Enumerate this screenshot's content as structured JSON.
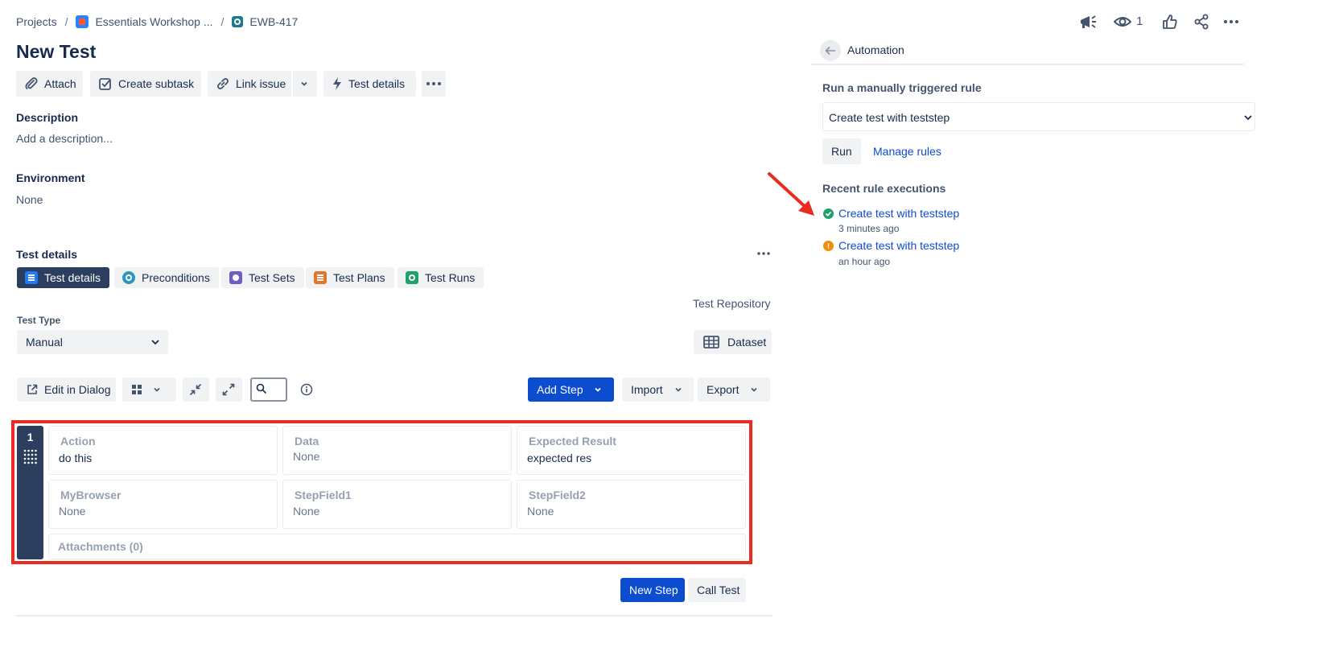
{
  "breadcrumb": {
    "projects": "Projects",
    "project": "Essentials Workshop ...",
    "issue_key": "EWB-417"
  },
  "top_actions": {
    "watch_count": "1"
  },
  "issue": {
    "title": "New Test"
  },
  "toolbar": {
    "attach": "Attach",
    "create_subtask": "Create subtask",
    "link_issue": "Link issue",
    "test_details": "Test details"
  },
  "description": {
    "label": "Description",
    "placeholder": "Add a description..."
  },
  "environment": {
    "label": "Environment",
    "value": "None"
  },
  "test_details_section": {
    "label": "Test details",
    "tabs": [
      {
        "label": "Test details",
        "color": "#1d7afc"
      },
      {
        "label": "Preconditions",
        "color": "#2898bd"
      },
      {
        "label": "Test Sets",
        "color": "#6e5dc6"
      },
      {
        "label": "Test Plans",
        "color": "#e2762c"
      },
      {
        "label": "Test Runs",
        "color": "#22a06b"
      }
    ],
    "test_repository": "Test Repository",
    "test_type_label": "Test Type",
    "test_type_value": "Manual",
    "dataset": "Dataset"
  },
  "steps_toolbar": {
    "edit_in_dialog": "Edit in Dialog",
    "add_step": "Add Step",
    "import": "Import",
    "export": "Export"
  },
  "step": {
    "number": "1",
    "action_label": "Action",
    "action_value": "do this",
    "data_label": "Data",
    "data_value": "None",
    "expected_label": "Expected Result",
    "expected_value": "expected res",
    "mybrowser_label": "MyBrowser",
    "mybrowser_value": "None",
    "stepfield1_label": "StepField1",
    "stepfield1_value": "None",
    "stepfield2_label": "StepField2",
    "stepfield2_value": "None",
    "attachments_label": "Attachments (0)"
  },
  "step_actions": {
    "new_step": "New Step",
    "call_test": "Call Test"
  },
  "automation": {
    "title": "Automation",
    "manual_rule_label": "Run a manually triggered rule",
    "rule_selected": "Create test with teststep",
    "run": "Run",
    "manage_rules": "Manage rules",
    "recent_label": "Recent rule executions",
    "executions": [
      {
        "name": "Create test with teststep",
        "time": "3 minutes ago",
        "status_color": "#22a06b"
      },
      {
        "name": "Create test with teststep",
        "time": "an hour ago",
        "status_color": "#f18d13"
      }
    ]
  },
  "colors": {
    "primary": "#0c4ccf",
    "annotation_red": "#ea2b1f",
    "link": "#0c66e4"
  }
}
